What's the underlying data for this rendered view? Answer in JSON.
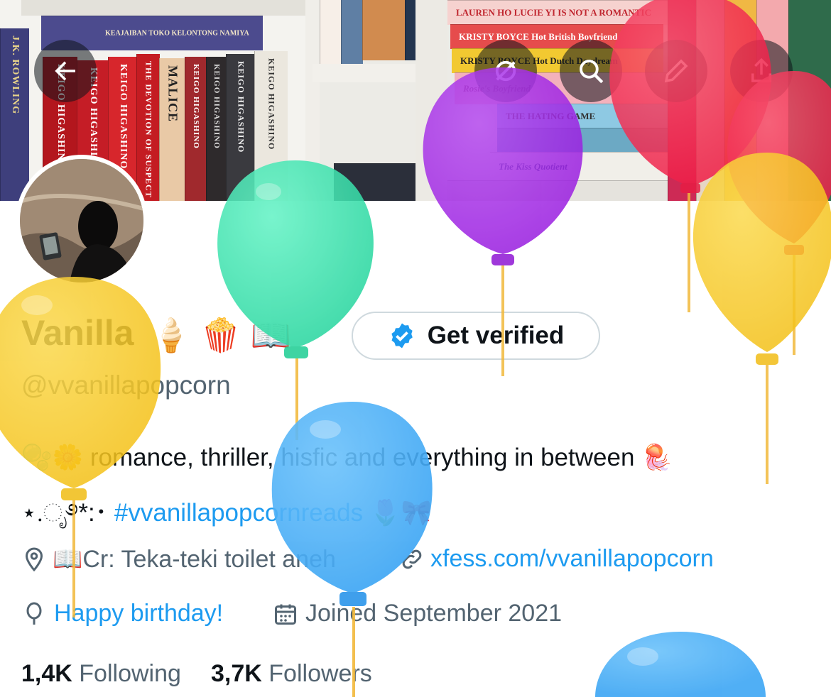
{
  "banner": {
    "book_spines": [
      "J.K. ROWLING",
      "KEIGO HIGASHINO",
      "KEIGO HIGASHINO",
      "THE DEVOTION OF SUSPECT X",
      "MALICE",
      "KEIGO HIGASHINO",
      "KEIGO HIGASHINO",
      "KEIGO HIGASHINO",
      "KEIGO HIGASHINO"
    ],
    "top_book": "KEAJAIBAN TOKO KELONTONG NAMIYA",
    "stack_books": [
      "LAUREN HO    LUCIE YI IS NOT A ROMANTIC",
      "KRISTY BOYCE    Hot British Boyfriend",
      "KRISTY BOYCE    Hot Dutch Daydream",
      "Rosie's Boyfriend",
      "THE HATING GAME",
      "The Kiss Quotient"
    ]
  },
  "profile": {
    "name": "Vanilla",
    "name_emojis": "🍦 🍿 📖",
    "handle": "@vvanillapopcorn",
    "verify_label": "Get verified",
    "bio_line1_emoji": "🫧🌼",
    "bio_line1_text": "romance, thriller, hisfic and everything in between",
    "bio_line1_end": "🪼",
    "bio_line2_prefix": "⋆.ೃ࿔*:･",
    "bio_hashtag": "#vvanillapopcornreads",
    "bio_line2_suffix": "🌷🎀",
    "location": "📖Cr: Teka-teki toilet aneh",
    "website": "xfess.com/vvanillapopcorn",
    "birthday": "Happy birthday!",
    "joined": "Joined September 2021",
    "following_count": "1,4K",
    "following_label": "Following",
    "followers_count": "3,7K",
    "followers_label": "Followers"
  },
  "colors": {
    "link": "#1d9bf0",
    "muted": "#536471",
    "balloon_green": "#3fe6b2",
    "balloon_purple": "#a425e8",
    "balloon_pink": "#f5274f",
    "balloon_yellow": "#f8cc2a",
    "balloon_blue": "#52b3f8"
  }
}
